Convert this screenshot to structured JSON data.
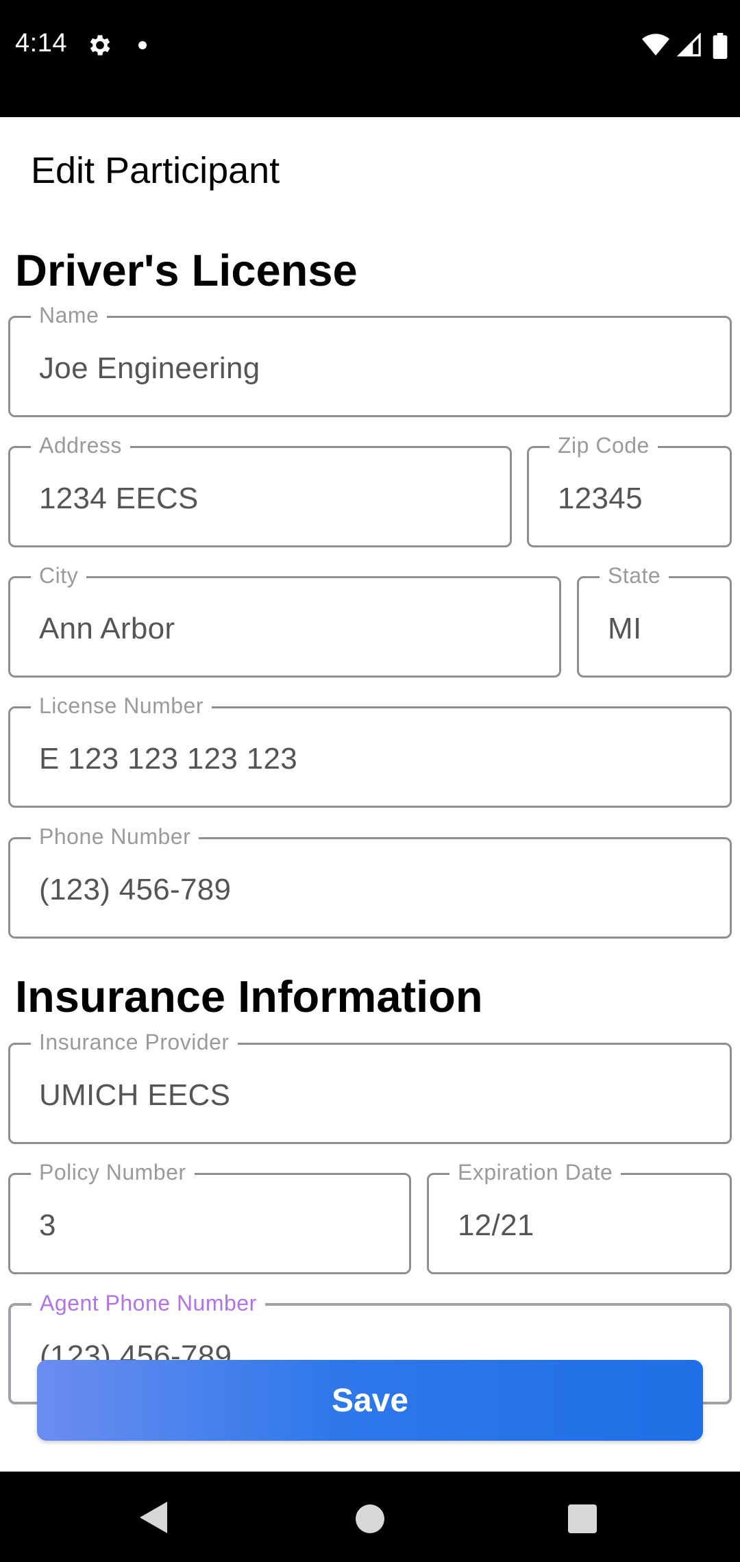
{
  "status_bar": {
    "time": "4:14",
    "icons": [
      "gear-icon",
      "notification-dot-icon",
      "wifi-icon",
      "signal-icon",
      "battery-icon"
    ]
  },
  "header": {
    "title": "Edit Participant"
  },
  "drivers_license": {
    "section_title": "Driver's License",
    "name": {
      "label": "Name",
      "value": "Joe Engineering"
    },
    "address": {
      "label": "Address",
      "value": "1234 EECS"
    },
    "zip_code": {
      "label": "Zip Code",
      "value": "12345"
    },
    "city": {
      "label": "City",
      "value": "Ann Arbor"
    },
    "state": {
      "label": "State",
      "value": "MI"
    },
    "license_number": {
      "label": "License Number",
      "value": "E 123 123 123 123"
    },
    "phone_number": {
      "label": "Phone Number",
      "value": "(123) 456-789"
    }
  },
  "insurance": {
    "section_title": "Insurance Information",
    "provider": {
      "label": "Insurance Provider",
      "value": "UMICH EECS"
    },
    "policy_number": {
      "label": "Policy Number",
      "value": "3"
    },
    "expiration_date": {
      "label": "Expiration Date",
      "value": "12/21"
    },
    "agent_phone": {
      "label": "Agent Phone Number",
      "value": "(123) 456-789"
    }
  },
  "actions": {
    "save_label": "Save"
  },
  "colors": {
    "focused_label": "#b173e6",
    "save_button_start": "#6b8df0",
    "save_button_end": "#1f6fe6",
    "field_border": "#8e8e8e"
  },
  "navigation": {
    "icons": [
      "back-icon",
      "home-icon",
      "recents-icon"
    ]
  }
}
